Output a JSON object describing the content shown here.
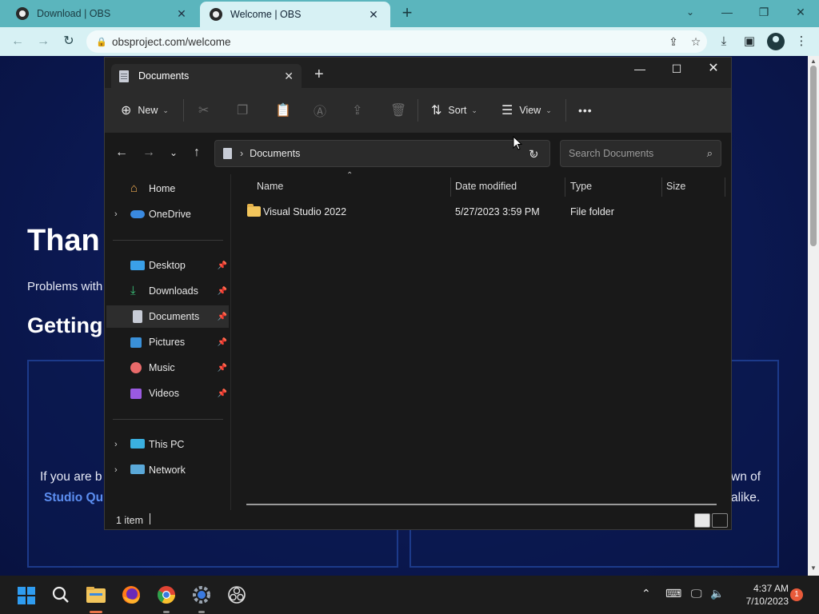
{
  "browser": {
    "tabs": [
      {
        "title": "Download | OBS",
        "active": false
      },
      {
        "title": "Welcome | OBS",
        "active": true
      }
    ],
    "new_tab_icon": "plus-icon",
    "url": "obsproject.com/welcome"
  },
  "webpage": {
    "heading": "Than",
    "problems_text": "Problems with",
    "subheading": "Getting",
    "card_left_text": "If you are b",
    "card_left_link": "Studio Qu",
    "card_right_text1": "wn of",
    "card_right_text2": "alike."
  },
  "explorer": {
    "tab_title": "Documents",
    "commands": {
      "new": "New",
      "sort": "Sort",
      "view": "View",
      "more": "•••"
    },
    "breadcrumb": "Documents",
    "search_placeholder": "Search Documents",
    "nav": {
      "home": "Home",
      "onedrive": "OneDrive",
      "desktop": "Desktop",
      "downloads": "Downloads",
      "documents": "Documents",
      "pictures": "Pictures",
      "music": "Music",
      "videos": "Videos",
      "this_pc": "This PC",
      "network": "Network"
    },
    "columns": {
      "name": "Name",
      "date": "Date modified",
      "type": "Type",
      "size": "Size"
    },
    "files": [
      {
        "name": "Visual Studio 2022",
        "date": "5/27/2023 3:59 PM",
        "type": "File folder",
        "size": ""
      }
    ],
    "status": "1 item"
  },
  "taskbar": {
    "time": "4:37 AM",
    "date": "7/10/2023",
    "notification_count": "1"
  },
  "colors": {
    "browser_tab_bg": "#5bb5bd",
    "browser_toolbar": "#d7f1f4",
    "explorer_bg": "#191919",
    "page_bg": "#0b1850",
    "taskbar_bg": "#1c1c1c",
    "accent_orange": "#e8734a"
  }
}
